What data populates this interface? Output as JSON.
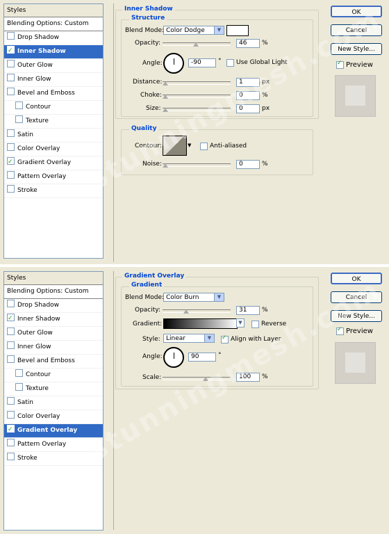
{
  "watermark": "stunningmesh.com",
  "panels": [
    {
      "styles_title": "Styles",
      "blending_label": "Blending Options: Custom",
      "items": [
        {
          "label": "Drop Shadow",
          "checked": false,
          "selected": false,
          "sub": false
        },
        {
          "label": "Inner Shadow",
          "checked": true,
          "selected": true,
          "sub": false
        },
        {
          "label": "Outer Glow",
          "checked": false,
          "selected": false,
          "sub": false
        },
        {
          "label": "Inner Glow",
          "checked": false,
          "selected": false,
          "sub": false
        },
        {
          "label": "Bevel and Emboss",
          "checked": false,
          "selected": false,
          "sub": false
        },
        {
          "label": "Contour",
          "checked": false,
          "selected": false,
          "sub": true
        },
        {
          "label": "Texture",
          "checked": false,
          "selected": false,
          "sub": true
        },
        {
          "label": "Satin",
          "checked": false,
          "selected": false,
          "sub": false
        },
        {
          "label": "Color Overlay",
          "checked": false,
          "selected": false,
          "sub": false
        },
        {
          "label": "Gradient Overlay",
          "checked": true,
          "selected": false,
          "sub": false
        },
        {
          "label": "Pattern Overlay",
          "checked": false,
          "selected": false,
          "sub": false
        },
        {
          "label": "Stroke",
          "checked": false,
          "selected": false,
          "sub": false
        }
      ],
      "section_title": "Inner Shadow",
      "group1_title": "Structure",
      "blend_mode_label": "Blend Mode:",
      "blend_mode_value": "Color Dodge",
      "opacity_label": "Opacity:",
      "opacity_value": "46",
      "opacity_pct": 0.46,
      "angle_label": "Angle:",
      "angle_value": "-90",
      "angle_unit": "°",
      "global_light_label": "Use Global Light",
      "distance_label": "Distance:",
      "distance_value": "1",
      "choke_label": "Choke:",
      "choke_value": "0",
      "size_label": "Size:",
      "size_value": "0",
      "unit_px": "px",
      "unit_pct": "%",
      "group2_title": "Quality",
      "contour_label": "Contour:",
      "anti_aliased_label": "Anti-aliased",
      "noise_label": "Noise:",
      "noise_value": "0",
      "ok_label": "OK",
      "cancel_label": "Cancel",
      "new_style_label": "New Style...",
      "preview_label": "Preview"
    },
    {
      "styles_title": "Styles",
      "blending_label": "Blending Options: Custom",
      "items": [
        {
          "label": "Drop Shadow",
          "checked": false,
          "selected": false,
          "sub": false
        },
        {
          "label": "Inner Shadow",
          "checked": true,
          "selected": false,
          "sub": false
        },
        {
          "label": "Outer Glow",
          "checked": false,
          "selected": false,
          "sub": false
        },
        {
          "label": "Inner Glow",
          "checked": false,
          "selected": false,
          "sub": false
        },
        {
          "label": "Bevel and Emboss",
          "checked": false,
          "selected": false,
          "sub": false
        },
        {
          "label": "Contour",
          "checked": false,
          "selected": false,
          "sub": true
        },
        {
          "label": "Texture",
          "checked": false,
          "selected": false,
          "sub": true
        },
        {
          "label": "Satin",
          "checked": false,
          "selected": false,
          "sub": false
        },
        {
          "label": "Color Overlay",
          "checked": false,
          "selected": false,
          "sub": false
        },
        {
          "label": "Gradient Overlay",
          "checked": true,
          "selected": true,
          "sub": false
        },
        {
          "label": "Pattern Overlay",
          "checked": false,
          "selected": false,
          "sub": false
        },
        {
          "label": "Stroke",
          "checked": false,
          "selected": false,
          "sub": false
        }
      ],
      "section_title": "Gradient Overlay",
      "group1_title": "Gradient",
      "blend_mode_label": "Blend Mode:",
      "blend_mode_value": "Color Burn",
      "opacity_label": "Opacity:",
      "opacity_value": "31",
      "opacity_pct": 0.31,
      "gradient_label": "Gradient:",
      "reverse_label": "Reverse",
      "style_label": "Style:",
      "style_value": "Linear",
      "align_label": "Align with Layer",
      "angle_label": "Angle:",
      "angle_value": "90",
      "angle_unit": "°",
      "scale_label": "Scale:",
      "scale_value": "100",
      "unit_pct": "%",
      "ok_label": "OK",
      "cancel_label": "Cancel",
      "new_style_label": "New Style...",
      "preview_label": "Preview"
    }
  ]
}
